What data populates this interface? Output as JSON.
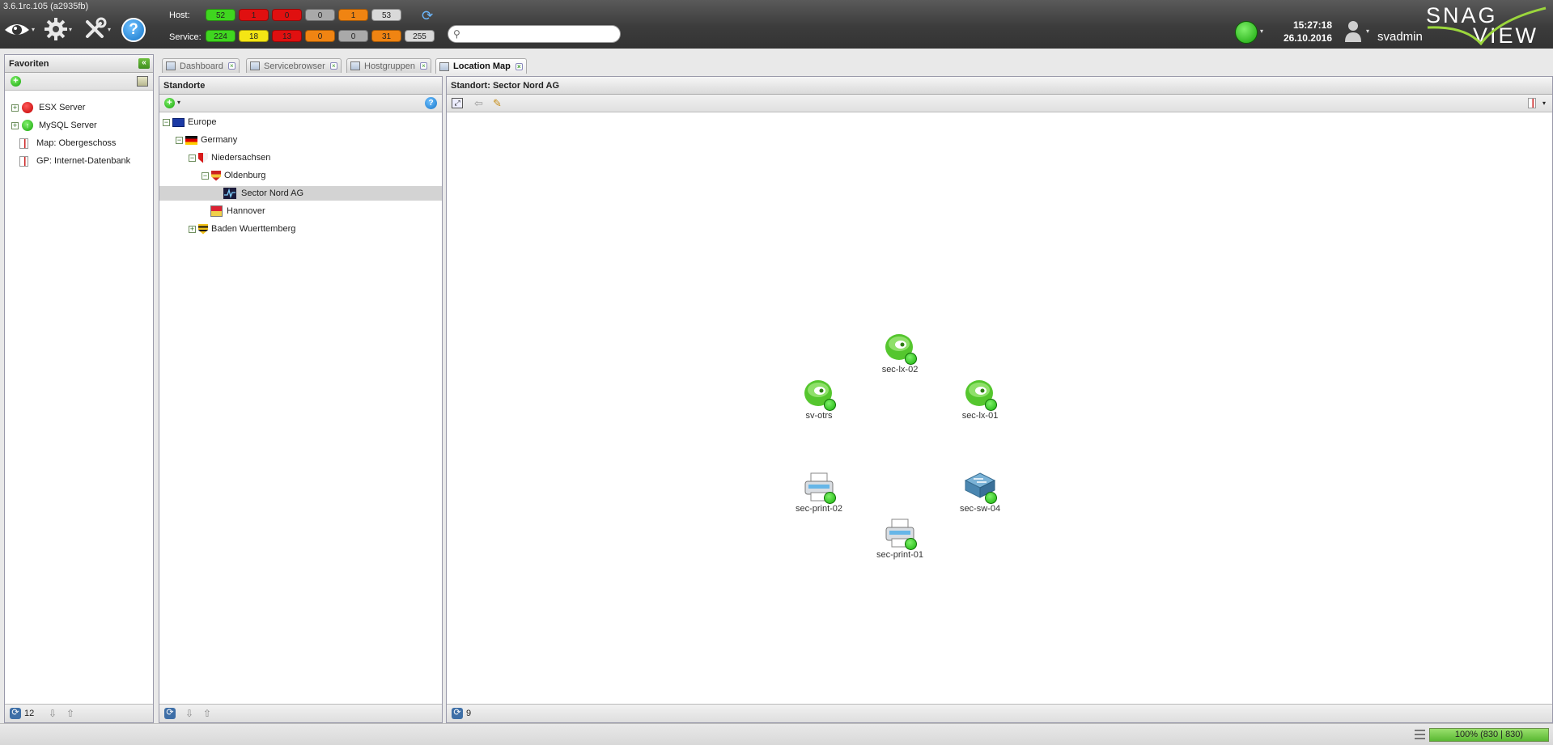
{
  "app": {
    "version": "3.6.1rc.105 (a2935fb)",
    "clock_time": "15:27:18",
    "clock_date": "26.10.2016",
    "username": "svadmin",
    "logo_text": "SNAG VIEW",
    "status_color": "#21b512"
  },
  "stats": {
    "host_label": "Host:",
    "service_label": "Service:",
    "host": [
      {
        "value": "52",
        "color": "#3fd61f"
      },
      {
        "value": "1",
        "color": "#e01010"
      },
      {
        "value": "0",
        "color": "#e01010"
      },
      {
        "value": "0",
        "color": "#a9a9a9"
      },
      {
        "value": "1",
        "color": "#f08412"
      },
      {
        "value": "53",
        "color": "#d9d9d9"
      }
    ],
    "service": [
      {
        "value": "224",
        "color": "#3fd61f"
      },
      {
        "value": "18",
        "color": "#f4e514"
      },
      {
        "value": "13",
        "color": "#e01010"
      },
      {
        "value": "0",
        "color": "#f08412"
      },
      {
        "value": "0",
        "color": "#a9a9a9"
      },
      {
        "value": "31",
        "color": "#f08412"
      },
      {
        "value": "255",
        "color": "#d9d9d9"
      }
    ]
  },
  "search": {
    "placeholder": ""
  },
  "favorites": {
    "title": "Favoriten",
    "items": [
      {
        "label": "ESX Server",
        "icon": "red-status-icon"
      },
      {
        "label": "MySQL Server",
        "icon": "green-status-icon"
      },
      {
        "label": "Map: Obergeschoss",
        "icon": "map-icon"
      },
      {
        "label": "GP: Internet-Datenbank",
        "icon": "map-icon"
      }
    ],
    "footer_count": "12"
  },
  "tabs": [
    {
      "label": "Dashboard",
      "active": false
    },
    {
      "label": "Servicebrowser",
      "active": false
    },
    {
      "label": "Hostgruppen",
      "active": false
    },
    {
      "label": "Location Map",
      "active": true
    }
  ],
  "locations": {
    "title": "Standorte",
    "tree": [
      {
        "label": "Europe",
        "level": 0,
        "expander": "−",
        "icon": "eu-flag-icon"
      },
      {
        "label": "Germany",
        "level": 1,
        "expander": "−",
        "icon": "germany-flag-icon"
      },
      {
        "label": "Niedersachsen",
        "level": 2,
        "expander": "−",
        "icon": "niedersachsen-shield-icon"
      },
      {
        "label": "Oldenburg",
        "level": 3,
        "expander": "−",
        "icon": "oldenburg-shield-icon"
      },
      {
        "label": "Sector Nord AG",
        "level": 4,
        "expander": "",
        "icon": "location-map-icon",
        "selected": true
      },
      {
        "label": "Hannover",
        "level": 3,
        "expander": "",
        "icon": "hannover-shield-icon"
      },
      {
        "label": "Baden Wuerttemberg",
        "level": 2,
        "expander": "+",
        "icon": "bw-shield-icon"
      }
    ]
  },
  "map": {
    "title": "Standort: Sector Nord AG",
    "footer_count": "9",
    "nodes": [
      {
        "label": "sec-lx-02",
        "type": "server"
      },
      {
        "label": "sv-otrs",
        "type": "server"
      },
      {
        "label": "sec-lx-01",
        "type": "server"
      },
      {
        "label": "sec-print-02",
        "type": "printer"
      },
      {
        "label": "sec-sw-04",
        "type": "switch"
      },
      {
        "label": "sec-print-01",
        "type": "printer"
      }
    ]
  },
  "statusbar": {
    "memory": "100% (830 | 830)"
  }
}
